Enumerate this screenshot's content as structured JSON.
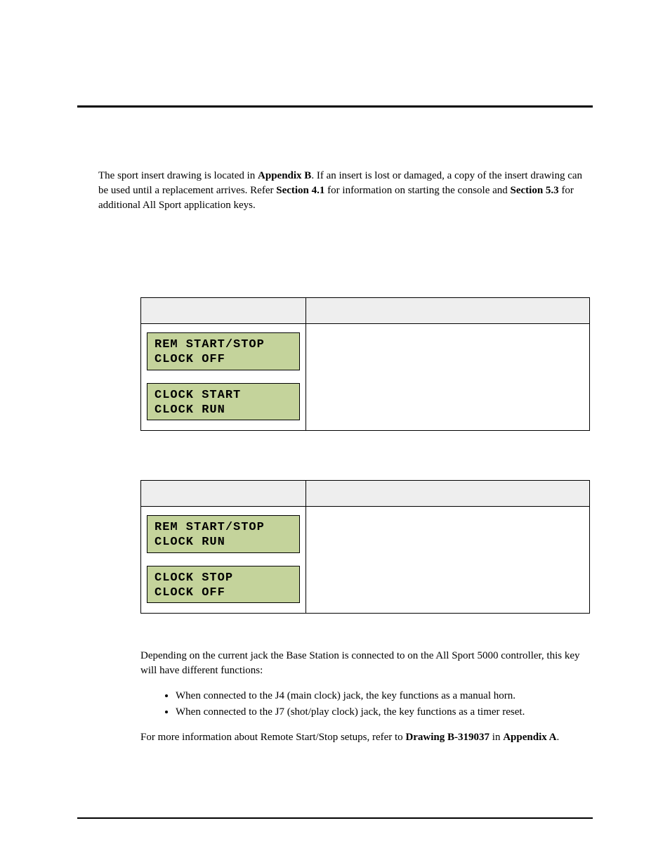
{
  "intro": {
    "part1": "The sport insert drawing is located in ",
    "bold1": "Appendix B",
    "part2": ". If an insert is lost or damaged, a copy of the insert drawing can be used until a replacement arrives. Refer ",
    "bold2": "Section 4.1",
    "part3": " for information on starting the console and ",
    "bold3": "Section 5.3",
    "part4": " for additional All Sport application keys."
  },
  "table1": {
    "lcd1_line1": "REM START/STOP",
    "lcd1_line2": "CLOCK OFF",
    "lcd2_line1": "CLOCK START",
    "lcd2_line2": "CLOCK RUN"
  },
  "table2": {
    "lcd1_line1": "REM START/STOP",
    "lcd1_line2": "CLOCK RUN",
    "lcd2_line1": "CLOCK STOP",
    "lcd2_line2": "CLOCK OFF"
  },
  "body": {
    "p1": "Depending on the current jack the Base Station is connected to on the All Sport 5000 controller, this key will have different functions:",
    "li1": "When connected to the J4 (main clock) jack, the key functions as a manual horn.",
    "li2": "When connected to the J7 (shot/play clock) jack, the key functions as a timer reset.",
    "p2a": "For more information about Remote Start/Stop setups, refer to ",
    "p2b_bold": "Drawing B-319037",
    "p2c": " in ",
    "p2d_bold": "Appendix A",
    "p2e": "."
  }
}
